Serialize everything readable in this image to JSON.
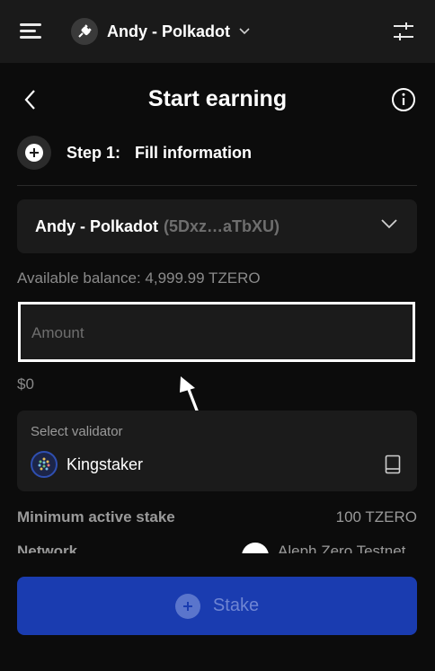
{
  "topbar": {
    "account_name": "Andy - Polkadot",
    "icons": {
      "menu": "hamburger-icon",
      "avatar": "plug-icon",
      "dropdown": "chevron-down-icon",
      "settings": "sliders-icon"
    }
  },
  "header": {
    "title": "Start earning",
    "icons": {
      "back": "chevron-left-icon",
      "info": "info-icon"
    }
  },
  "step": {
    "number": "Step 1:",
    "label": "Fill information",
    "icon": "plus-circle-icon"
  },
  "account_select": {
    "name": "Andy - Polkadot",
    "address": "(5Dxz…aTbXU)",
    "icon": "chevron-down-icon"
  },
  "balance": {
    "label": "Available balance:",
    "value": "4,999.99 TZERO"
  },
  "amount": {
    "placeholder": "Amount",
    "value": ""
  },
  "usd_value": "$0",
  "validator": {
    "label": "Select validator",
    "name": "Kingstaker",
    "icons": {
      "logo": "kingstaker-logo-icon",
      "book": "book-icon"
    }
  },
  "details": {
    "min_stake_label": "Minimum active stake",
    "min_stake_value": "100 TZERO",
    "network_label": "Network",
    "network_value": "Aleph Zero Testnet"
  },
  "stake_button": {
    "label": "Stake",
    "icon": "plus-circle-icon"
  },
  "colors": {
    "background": "#0c0c0c",
    "panel": "#1b1b1b",
    "topbar": "#1a1a1a",
    "primary": "#1a3cb0",
    "muted_text": "#8a8a8a",
    "highlight_border": "#ffffff"
  }
}
